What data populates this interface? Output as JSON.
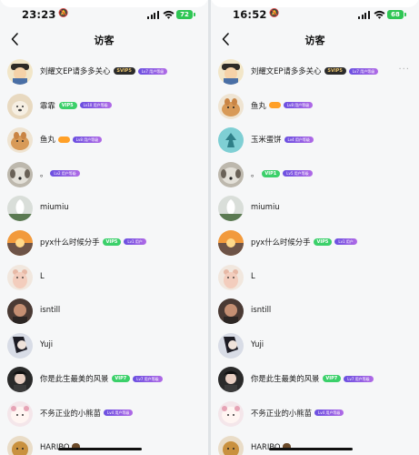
{
  "left_screen": {
    "status_bar": {
      "time": "23:23",
      "battery": "72"
    },
    "nav": {
      "title": "访客"
    },
    "visitors": [
      {
        "name": "刘耀文EP请多多关心",
        "vip": "SVIP5",
        "vip_style": "gold",
        "level": "Lv7 用户等级"
      },
      {
        "name": "霏霏",
        "vip": "VIP5",
        "vip_style": "green",
        "level": "Lv10 用户等级"
      },
      {
        "name": "鱼丸",
        "extra": "orange",
        "level": "Lv8 用户等级"
      },
      {
        "name": "。",
        "level": "Lv2 用户等级"
      },
      {
        "name": "miumiu"
      },
      {
        "name": "pyx什么时候分手",
        "vip": "VIP5",
        "vip_style": "green",
        "level": "Lv1 用户"
      },
      {
        "name": "L"
      },
      {
        "name": "isntill"
      },
      {
        "name": "Yuji"
      },
      {
        "name": "你是此生最美的风景",
        "vip": "VIP7",
        "vip_style": "green",
        "level": "Lv7 用户等级"
      },
      {
        "name": "不务正业的小熊苗",
        "level": "Lv4 用户等级"
      },
      {
        "name": "HARIBO",
        "extra": "sticker"
      }
    ]
  },
  "right_screen": {
    "status_bar": {
      "time": "16:52",
      "battery": "68"
    },
    "nav": {
      "title": "访客"
    },
    "visitors": [
      {
        "name": "刘耀文EP请多多关心",
        "vip": "SVIP5",
        "vip_style": "gold",
        "level": "Lv7 用户等级"
      },
      {
        "name": "鱼丸",
        "extra": "orange",
        "level": "Lv8 用户等级"
      },
      {
        "name": "玉米蛋饼",
        "level": "Lv4 用户等级"
      },
      {
        "name": "。",
        "vip": "VIP1",
        "vip_style": "green",
        "level": "Lv5 用户等级"
      },
      {
        "name": "miumiu"
      },
      {
        "name": "pyx什么时候分手",
        "vip": "VIP5",
        "vip_style": "green",
        "level": "Lv1 用户"
      },
      {
        "name": "L"
      },
      {
        "name": "isntill"
      },
      {
        "name": "Yuji"
      },
      {
        "name": "你是此生最美的风景",
        "vip": "VIP7",
        "vip_style": "green",
        "level": "Lv7 用户等级"
      },
      {
        "name": "不务正业的小熊苗",
        "level": "Lv4 用户等级"
      },
      {
        "name": "HARIBO",
        "extra": "sticker"
      }
    ]
  },
  "colors": {
    "vip_green": "#3bd06a",
    "svip_bg": "#2b2b2b",
    "svip_text": "#e7c26d",
    "level_purple": "#7b5ce5",
    "battery_green": "#2fc654"
  },
  "icons": {
    "back": "chevron-left-icon",
    "more": "more-dots-icon",
    "signal": "cellular-signal-icon",
    "wifi": "wifi-icon",
    "mute": "bell-slash-icon"
  }
}
